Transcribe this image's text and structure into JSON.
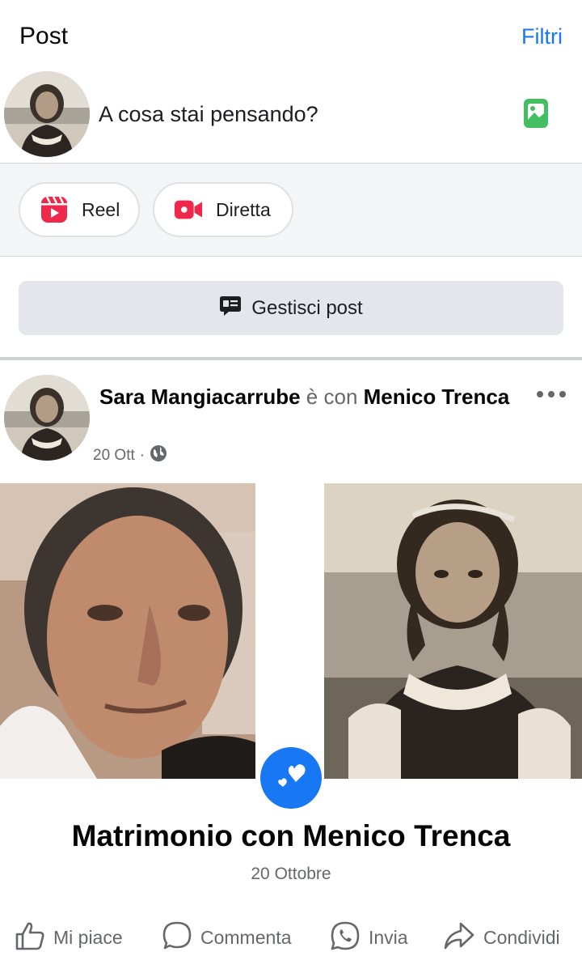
{
  "header": {
    "title": "Post",
    "filter_label": "Filtri"
  },
  "composer": {
    "placeholder": "A cosa stai pensando?",
    "photo_icon": "photo-icon"
  },
  "quick_actions": [
    {
      "label": "Reel",
      "icon": "reel-icon"
    },
    {
      "label": "Diretta",
      "icon": "live-video-icon"
    }
  ],
  "manage": {
    "label": "Gestisci post",
    "icon": "manage-posts-icon"
  },
  "post": {
    "author": "Sara Mangiacarrube",
    "with_text": "è con",
    "tagged": "Menico Trenca",
    "date": "20 Ott",
    "separator": "·",
    "privacy_icon": "globe-icon",
    "event_title": "Matrimonio con Menico Trenca",
    "event_date": "20 Ottobre"
  },
  "actions": [
    {
      "label": "Mi piace",
      "icon": "like-icon"
    },
    {
      "label": "Commenta",
      "icon": "comment-icon"
    },
    {
      "label": "Invia",
      "icon": "whatsapp-icon"
    },
    {
      "label": "Condividi",
      "icon": "share-icon"
    }
  ],
  "colors": {
    "accent": "#1877f2",
    "photo_icon": "#45bd62",
    "reel": "#f02849",
    "live": "#f02849",
    "secondary_text": "#65676b"
  }
}
